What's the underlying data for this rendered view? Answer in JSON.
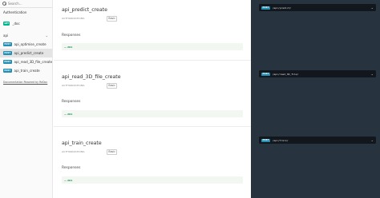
{
  "sidebar": {
    "search_placeholder": "Search...",
    "auth_label": "Authentication",
    "items": [
      {
        "badge": "GET",
        "label": "_doc"
      },
      {
        "label": "api"
      },
      {
        "badge": "POST",
        "label": "api_optimise_create"
      },
      {
        "badge": "POST",
        "label": "api_predict_create"
      },
      {
        "badge": "POST",
        "label": "api_read_3D_file_create"
      },
      {
        "badge": "POST",
        "label": "api_train_create"
      }
    ],
    "doc_link": "Documentation Powered by ReDoc"
  },
  "sections": [
    {
      "title": "api_predict_create",
      "auth_label": "AUTHORIZATIONS:",
      "auth_value": "Basic",
      "responses_label": "Responses",
      "response_code": "— 201"
    },
    {
      "title": "api_read_3D_file_create",
      "auth_label": "AUTHORIZATIONS:",
      "auth_value": "Basic",
      "responses_label": "Responses",
      "response_code": "— 201"
    },
    {
      "title": "api_train_create",
      "auth_label": "AUTHORIZATIONS:",
      "auth_value": "Basic",
      "responses_label": "Responses",
      "response_code": "— 201"
    }
  ],
  "endpoints": [
    {
      "method": "POST",
      "path": "/api/predict/"
    },
    {
      "method": "POST",
      "path": "/api/read_3D_file/"
    },
    {
      "method": "POST",
      "path": "/api/train/"
    }
  ],
  "icons": {
    "search": "search-icon",
    "chevron": "chevron-icon"
  }
}
